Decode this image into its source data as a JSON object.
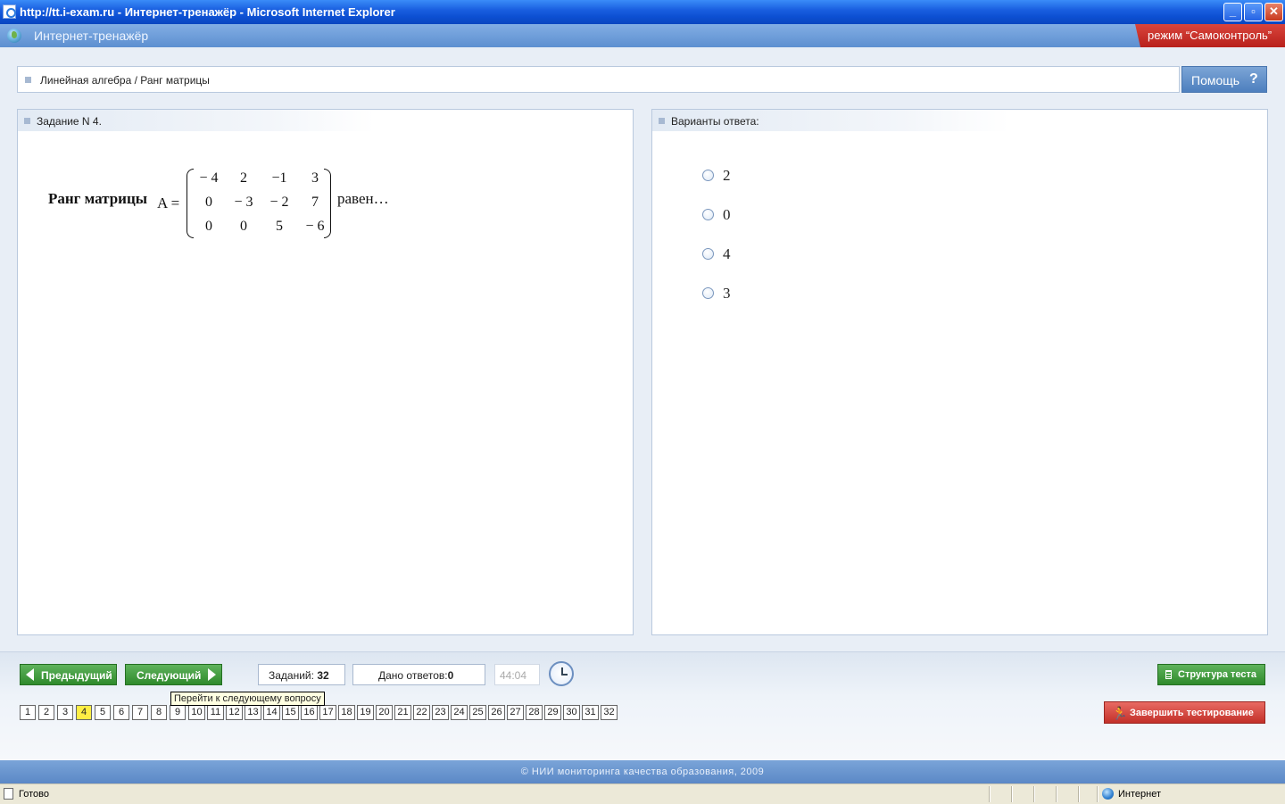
{
  "browser": {
    "title": "http://tt.i-exam.ru - Интернет-тренажёр - Microsoft Internet Explorer",
    "minimize_label": "_",
    "maximize_label": "▫",
    "close_label": "✕"
  },
  "app": {
    "title": "Интернет-тренажёр",
    "mode": "режим “Самоконтроль”"
  },
  "breadcrumb": "Линейная алгебра / Ранг матрицы",
  "help": {
    "label": "Помощь",
    "icon": "?"
  },
  "task": {
    "header": "Задание N 4.",
    "prefix": "Ранг матрицы",
    "variable": "A =",
    "matrix": [
      [
        "− 4",
        "2",
        "−1",
        "3"
      ],
      [
        "0",
        "− 3",
        "− 2",
        "7"
      ],
      [
        "0",
        "0",
        "5",
        "− 6"
      ]
    ],
    "suffix": "равен…"
  },
  "answers": {
    "header": "Варианты ответа:",
    "options": [
      "2",
      "0",
      "4",
      "3"
    ]
  },
  "nav": {
    "prev_label": "Предыдущий",
    "next_label": "Следующий",
    "next_tooltip": "Перейти к следующему вопросу",
    "total_label": "Заданий:",
    "total_value": "32",
    "answered_label": "Дано ответов:",
    "answered_value": "0",
    "timer": "44:04",
    "current_question": 4,
    "questions": [
      "1",
      "2",
      "3",
      "4",
      "5",
      "6",
      "7",
      "8",
      "9",
      "10",
      "11",
      "12",
      "13",
      "14",
      "15",
      "16",
      "17",
      "18",
      "19",
      "20",
      "21",
      "22",
      "23",
      "24",
      "25",
      "26",
      "27",
      "28",
      "29",
      "30",
      "31",
      "32"
    ],
    "structure_label": "Структура теста",
    "finish_label": "Завершить тестирование"
  },
  "footer": "© НИИ мониторинга качества образования, 2009",
  "status": {
    "text": "Готово",
    "zone": "Интернет"
  }
}
